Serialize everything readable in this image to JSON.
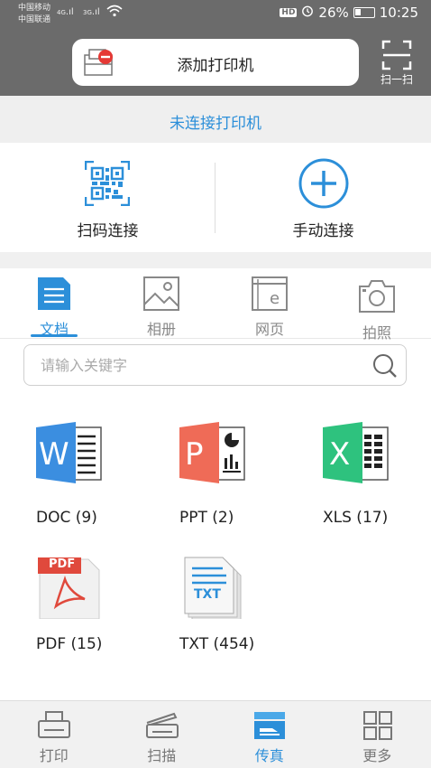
{
  "status_bar": {
    "carrier1": "中国移动",
    "carrier2": "中国联通",
    "net1": "4G",
    "net2": "3G",
    "hd": "HD",
    "battery": "26%",
    "time": "10:25"
  },
  "header": {
    "add_printer_label": "添加打印机",
    "scan_label": "扫一扫"
  },
  "connection_status": "未连接打印机",
  "connect_options": {
    "qr_label": "扫码连接",
    "manual_label": "手动连接"
  },
  "tabs": [
    {
      "label": "文档",
      "icon": "document-icon",
      "active": true
    },
    {
      "label": "相册",
      "icon": "image-icon",
      "active": false
    },
    {
      "label": "网页",
      "icon": "webpage-icon",
      "active": false
    },
    {
      "label": "拍照",
      "icon": "camera-icon",
      "active": false
    }
  ],
  "search": {
    "placeholder": "请输入关键字",
    "value": ""
  },
  "files": [
    {
      "label": "DOC (9)",
      "icon": "word-file-icon"
    },
    {
      "label": "PPT (2)",
      "icon": "powerpoint-file-icon"
    },
    {
      "label": "XLS (17)",
      "icon": "excel-file-icon"
    },
    {
      "label": "PDF (15)",
      "icon": "pdf-file-icon",
      "badge": "PDF"
    },
    {
      "label": "TXT (454)",
      "icon": "txt-file-icon",
      "badge": "TXT"
    }
  ],
  "bottom_nav": [
    {
      "label": "打印",
      "icon": "print-icon",
      "active": false
    },
    {
      "label": "扫描",
      "icon": "scanner-icon",
      "active": false
    },
    {
      "label": "传真",
      "icon": "fax-icon",
      "active": true
    },
    {
      "label": "更多",
      "icon": "grid-more-icon",
      "active": false
    }
  ],
  "colors": {
    "accent": "#2c8fd9",
    "header_bg": "#6b6b6b",
    "word": "#3b8ee0",
    "powerpoint": "#ef6b57",
    "excel": "#2ec27e",
    "pdf_badge": "#e0493c",
    "error_badge": "#e53935"
  }
}
